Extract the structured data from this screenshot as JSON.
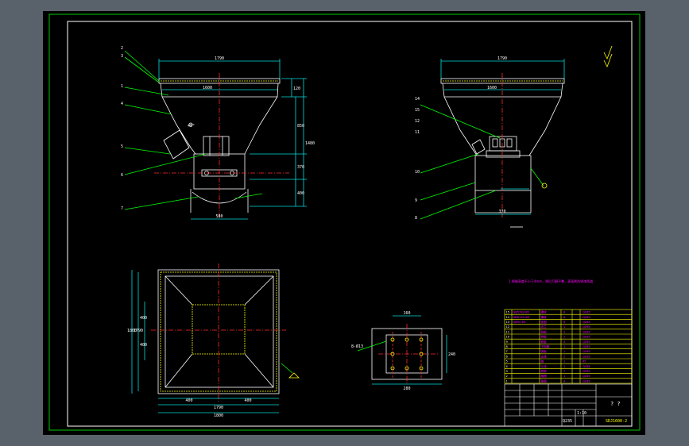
{
  "colors": {
    "frame": "#00c800",
    "outline": "#ffffff",
    "dimension": "#00dcdc",
    "center": "#ff2a2a",
    "leader": "#00ff00",
    "hatch": "#ffff00",
    "note": "#ff00ff",
    "table_grid": "#ffff00",
    "background_app": "#59616b",
    "canvas": "#000000"
  },
  "front_view": {
    "top_width": "1790",
    "inner_width": "1600",
    "bottom_width": "580",
    "angle_note": "45°",
    "heights": [
      "120",
      "850",
      "370",
      "400",
      "1480"
    ],
    "part_callouts": [
      "2",
      "3",
      "1",
      "4",
      "5",
      "6",
      "7"
    ]
  },
  "side_view": {
    "top_width": "1790",
    "inner_width": "1600",
    "bottom_width": "370",
    "part_callouts": [
      "14",
      "15",
      "12",
      "11",
      "10",
      "9",
      "8"
    ]
  },
  "plan_view": {
    "width_outer": "1790",
    "width_total": "1800",
    "height_outer": "1800",
    "height_inner": "1790",
    "inner_dims": [
      "400",
      "400"
    ],
    "side_dims": [
      "400",
      "400"
    ]
  },
  "flange_view": {
    "dims": [
      "160",
      "280",
      "240"
    ],
    "note_hole": "8-Ø13"
  },
  "notes": {
    "technical_requirement": "1.焊缝高度不小于4mm，焊后打磨平整，表面刷防锈漆两道"
  },
  "title_block": {
    "title": "? ?",
    "drawing_no": "SDJ1600-2",
    "scale": "1:10",
    "material": "Q235"
  },
  "bom": [
    {
      "no": "15",
      "code": "GB5783-85",
      "name": "螺栓",
      "qty": "8",
      "material": "Q235"
    },
    {
      "no": "14",
      "code": "GB6170-86",
      "name": "螺母",
      "qty": "8",
      "material": "Q235"
    },
    {
      "no": "13",
      "code": "GB95-85",
      "name": "垫圈",
      "qty": "8",
      "material": "Q235"
    },
    {
      "no": "12",
      "code": "",
      "name": "法兰",
      "qty": "1",
      "material": "Q235"
    },
    {
      "no": "11",
      "code": "",
      "name": "挡板",
      "qty": "2",
      "material": "Q235"
    },
    {
      "no": "10",
      "code": "",
      "name": "侧板",
      "qty": "2",
      "material": "Q235"
    },
    {
      "no": "9",
      "code": "",
      "name": "筋板",
      "qty": "4",
      "material": "Q235"
    },
    {
      "no": "8",
      "code": "",
      "name": "下料管",
      "qty": "1",
      "material": "Q235"
    },
    {
      "no": "7",
      "code": "",
      "name": "弧板",
      "qty": "1",
      "material": "Q235"
    },
    {
      "no": "6",
      "code": "",
      "name": "支座",
      "qty": "2",
      "material": "Q235"
    },
    {
      "no": "5",
      "code": "",
      "name": "轴",
      "qty": "1",
      "material": "45"
    },
    {
      "no": "4",
      "code": "",
      "name": "斗体",
      "qty": "1",
      "material": "Q235"
    },
    {
      "no": "3",
      "code": "",
      "name": "框架",
      "qty": "1",
      "material": "Q235"
    },
    {
      "no": "2",
      "code": "",
      "name": "格栅",
      "qty": "1",
      "material": "Q235"
    },
    {
      "no": "1",
      "code": "",
      "name": "角钢",
      "qty": "4",
      "material": "Q235"
    }
  ]
}
